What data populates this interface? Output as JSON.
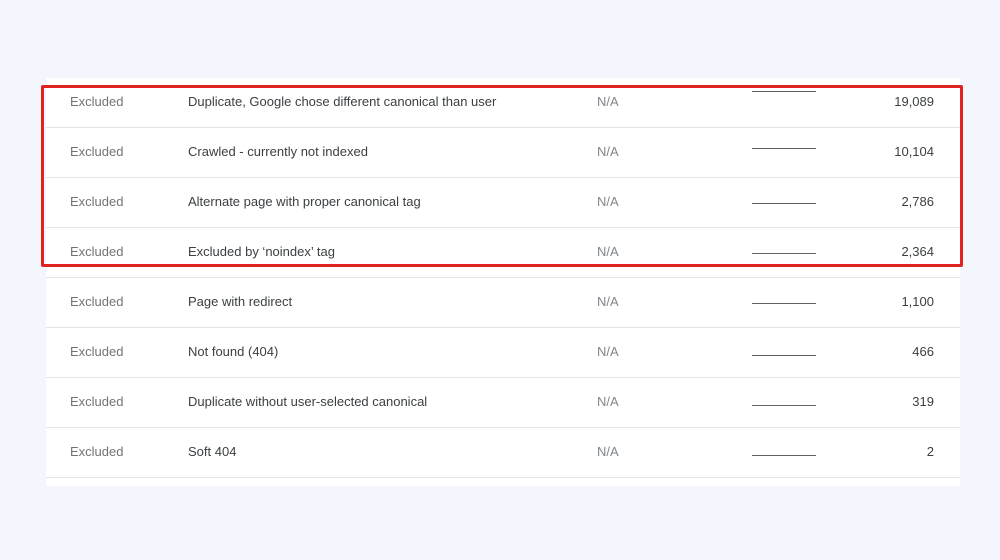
{
  "colors": {
    "background": "#f3f6fc",
    "highlight": "#e0231f"
  },
  "rows": [
    {
      "status": "Excluded",
      "reason": "Duplicate, Google chose different canonical than user",
      "validation": "N/A",
      "pages": "19,089"
    },
    {
      "status": "Excluded",
      "reason": "Crawled - currently not indexed",
      "validation": "N/A",
      "pages": "10,104"
    },
    {
      "status": "Excluded",
      "reason": "Alternate page with proper canonical tag",
      "validation": "N/A",
      "pages": "2,786"
    },
    {
      "status": "Excluded",
      "reason": "Excluded by ‘noindex’ tag",
      "validation": "N/A",
      "pages": "2,364"
    },
    {
      "status": "Excluded",
      "reason": "Page with redirect",
      "validation": "N/A",
      "pages": "1,100"
    },
    {
      "status": "Excluded",
      "reason": "Not found (404)",
      "validation": "N/A",
      "pages": "466"
    },
    {
      "status": "Excluded",
      "reason": "Duplicate without user-selected canonical",
      "validation": "N/A",
      "pages": "319"
    },
    {
      "status": "Excluded",
      "reason": "Soft 404",
      "validation": "N/A",
      "pages": "2"
    }
  ]
}
